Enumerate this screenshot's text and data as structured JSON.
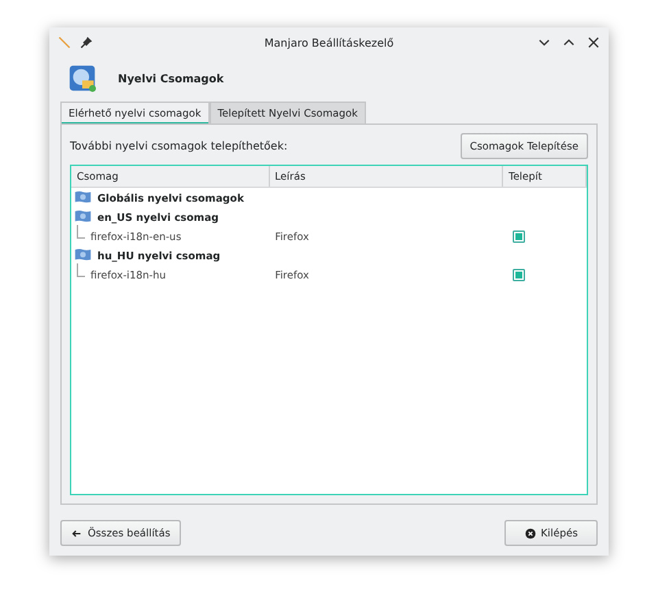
{
  "window": {
    "title": "Manjaro Beállításkezelő"
  },
  "header": {
    "title": "Nyelvi Csomagok"
  },
  "tabs": [
    {
      "label": "Elérhető nyelvi csomagok",
      "selected": true
    },
    {
      "label": "Telepített Nyelvi Csomagok",
      "selected": false
    }
  ],
  "panel": {
    "info": "További nyelvi csomagok telepíthetőek:",
    "install_button": "Csomagok Telepítése"
  },
  "table": {
    "columns": [
      "Csomag",
      "Leírás",
      "Telepít"
    ],
    "rows": [
      {
        "name": "Globális nyelvi csomagok"
      },
      {
        "name": "en_US nyelvi csomag",
        "children": [
          {
            "name": "firefox-i18n-en-us",
            "description": "Firefox",
            "checked": true
          }
        ]
      },
      {
        "name": "hu_HU nyelvi csomag",
        "children": [
          {
            "name": "firefox-i18n-hu",
            "description": "Firefox",
            "checked": true
          }
        ]
      }
    ]
  },
  "buttons": {
    "back": "Összes beállítás",
    "quit": "Kilépés"
  }
}
